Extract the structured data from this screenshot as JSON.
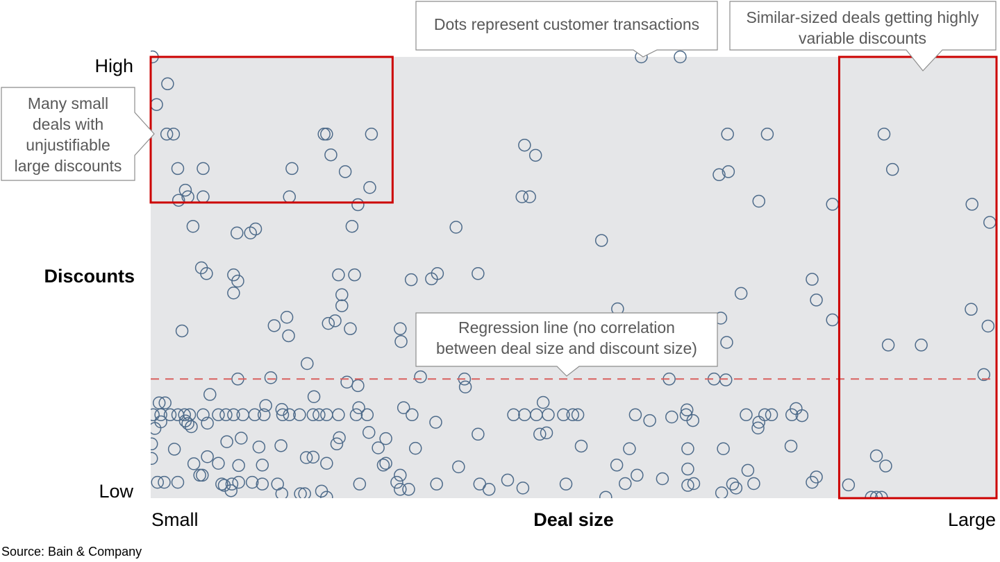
{
  "chart_data": {
    "type": "scatter",
    "title": "",
    "xlabel": "Deal size",
    "ylabel": "Discounts",
    "x_tick_labels": {
      "min": "Small",
      "max": "Large"
    },
    "y_tick_labels": {
      "min": "Low",
      "max": "High"
    },
    "xlim": [
      0,
      100
    ],
    "ylim": [
      0,
      100
    ],
    "grid": false,
    "colors": {
      "plot_bg": "#e5e6e8",
      "marker": "#4e6b8a",
      "regression": "#d9615f",
      "highlight": "#cc0000",
      "callout_border": "#8c8c8c",
      "callout_text": "#595959"
    },
    "regression_line": {
      "y": 27,
      "style": "dashed"
    },
    "highlight_regions": [
      {
        "name": "small-deals-large-discounts",
        "x": [
          0,
          28.6
        ],
        "y": [
          67,
          100
        ]
      },
      {
        "name": "large-deals-variable-discounts",
        "x": [
          81.4,
          100
        ],
        "y": [
          0,
          100
        ]
      }
    ],
    "annotations": [
      {
        "name": "many-small-deals",
        "text": [
          "Many small",
          "deals with",
          "unjustifiable",
          "large discounts"
        ]
      },
      {
        "name": "dots-represent",
        "text": [
          "Dots represent customer transactions"
        ]
      },
      {
        "name": "similar-sized-deals",
        "text": [
          "Similar-sized deals getting highly",
          "variable discounts"
        ]
      },
      {
        "name": "regression-line-note",
        "text": [
          "Regression line (no correlation",
          "between deal size and discount size)"
        ]
      }
    ],
    "points": [
      [
        0.2,
        100
      ],
      [
        2.0,
        93.9
      ],
      [
        0.7,
        89.2
      ],
      [
        1.9,
        82.5
      ],
      [
        2.7,
        82.5
      ],
      [
        3.2,
        74.7
      ],
      [
        6.2,
        74.7
      ],
      [
        16.7,
        74.7
      ],
      [
        20.5,
        82.5
      ],
      [
        20.8,
        82.5
      ],
      [
        21.3,
        77.8
      ],
      [
        26.1,
        82.5
      ],
      [
        23.0,
        74.0
      ],
      [
        25.9,
        70.4
      ],
      [
        4.1,
        69.8
      ],
      [
        3.3,
        67.5
      ],
      [
        4.4,
        68.3
      ],
      [
        6.2,
        68.3
      ],
      [
        16.4,
        68.3
      ],
      [
        24.5,
        66.5
      ],
      [
        5.0,
        61.6
      ],
      [
        10.2,
        60.1
      ],
      [
        11.8,
        60.1
      ],
      [
        12.4,
        61.0
      ],
      [
        23.8,
        61.6
      ],
      [
        6.0,
        52.2
      ],
      [
        6.6,
        50.9
      ],
      [
        9.8,
        50.6
      ],
      [
        10.3,
        49.2
      ],
      [
        9.8,
        46.5
      ],
      [
        22.2,
        50.6
      ],
      [
        24.1,
        50.6
      ],
      [
        22.6,
        46.1
      ],
      [
        22.6,
        43.6
      ],
      [
        3.7,
        37.9
      ],
      [
        14.6,
        39.1
      ],
      [
        16.1,
        41.0
      ],
      [
        16.3,
        36.8
      ],
      [
        21.0,
        39.6
      ],
      [
        21.8,
        40.2
      ],
      [
        23.6,
        38.4
      ],
      [
        18.5,
        30.5
      ],
      [
        10.3,
        27.0
      ],
      [
        14.2,
        27.3
      ],
      [
        23.2,
        26.3
      ],
      [
        24.5,
        25.5
      ],
      [
        29.5,
        38.4
      ],
      [
        29.6,
        35.5
      ],
      [
        31.9,
        27.5
      ],
      [
        37.1,
        27.0
      ],
      [
        37.2,
        25.2
      ],
      [
        30.8,
        49.5
      ],
      [
        33.2,
        49.7
      ],
      [
        33.9,
        50.9
      ],
      [
        38.7,
        50.9
      ],
      [
        36.1,
        61.4
      ],
      [
        43.9,
        68.3
      ],
      [
        44.8,
        68.3
      ],
      [
        44.2,
        80.0
      ],
      [
        45.5,
        77.7
      ],
      [
        53.3,
        58.4
      ],
      [
        55.2,
        42.9
      ],
      [
        58.0,
        100
      ],
      [
        62.6,
        100
      ],
      [
        68.2,
        82.5
      ],
      [
        72.9,
        82.5
      ],
      [
        67.2,
        73.3
      ],
      [
        68.3,
        74.0
      ],
      [
        71.9,
        67.3
      ],
      [
        80.6,
        66.6
      ],
      [
        69.8,
        46.4
      ],
      [
        78.2,
        49.6
      ],
      [
        78.7,
        44.9
      ],
      [
        67.4,
        40.8
      ],
      [
        68.1,
        35.3
      ],
      [
        80.6,
        40.4
      ],
      [
        68.0,
        26.8
      ],
      [
        61.3,
        27.0
      ],
      [
        66.6,
        27.0
      ],
      [
        86.7,
        82.5
      ],
      [
        87.7,
        74.5
      ],
      [
        97.1,
        66.6
      ],
      [
        99.2,
        62.5
      ],
      [
        97.0,
        42.8
      ],
      [
        99.0,
        39.0
      ],
      [
        87.2,
        34.7
      ],
      [
        91.1,
        34.7
      ],
      [
        98.5,
        28.0
      ],
      [
        85.8,
        9.6
      ],
      [
        86.9,
        7.3
      ],
      [
        82.5,
        3.0
      ],
      [
        85.2,
        0.2
      ],
      [
        85.8,
        0.2
      ],
      [
        86.4,
        0.2
      ],
      [
        0.3,
        18.9
      ],
      [
        1.0,
        21.6
      ],
      [
        1.7,
        21.6
      ],
      [
        1.2,
        18.9
      ],
      [
        2.3,
        18.9
      ],
      [
        3.2,
        18.9
      ],
      [
        4.0,
        18.9
      ],
      [
        4.6,
        18.9
      ],
      [
        6.2,
        18.9
      ],
      [
        8.0,
        18.9
      ],
      [
        8.9,
        18.9
      ],
      [
        9.8,
        18.9
      ],
      [
        10.9,
        18.9
      ],
      [
        12.3,
        18.9
      ],
      [
        13.4,
        18.9
      ],
      [
        15.6,
        18.9
      ],
      [
        16.4,
        18.9
      ],
      [
        17.6,
        18.9
      ],
      [
        19.2,
        18.9
      ],
      [
        19.9,
        18.9
      ],
      [
        20.8,
        18.9
      ],
      [
        22.2,
        18.9
      ],
      [
        24.3,
        18.9
      ],
      [
        25.6,
        18.9
      ],
      [
        15.5,
        20.1
      ],
      [
        13.6,
        21.0
      ],
      [
        1.2,
        17.3
      ],
      [
        0.5,
        15.8
      ],
      [
        4.1,
        17.5
      ],
      [
        4.4,
        16.9
      ],
      [
        4.8,
        16.2
      ],
      [
        6.7,
        17.0
      ],
      [
        7.0,
        23.5
      ],
      [
        19.3,
        23.0
      ],
      [
        24.6,
        20.5
      ],
      [
        0.1,
        12.3
      ],
      [
        0.1,
        9.0
      ],
      [
        2.8,
        11.1
      ],
      [
        5.1,
        7.8
      ],
      [
        6.1,
        5.2
      ],
      [
        6.7,
        9.4
      ],
      [
        8.0,
        7.9
      ],
      [
        9.0,
        12.8
      ],
      [
        10.4,
        7.4
      ],
      [
        10.7,
        13.6
      ],
      [
        12.8,
        11.6
      ],
      [
        13.2,
        7.5
      ],
      [
        15.4,
        11.9
      ],
      [
        18.4,
        9.2
      ],
      [
        19.2,
        9.3
      ],
      [
        20.8,
        7.9
      ],
      [
        22.0,
        12.3
      ],
      [
        22.3,
        13.7
      ],
      [
        25.8,
        14.9
      ],
      [
        27.5,
        7.5
      ],
      [
        27.8,
        7.9
      ],
      [
        26.9,
        11.4
      ],
      [
        27.8,
        13.5
      ],
      [
        31.3,
        11.3
      ],
      [
        0.8,
        3.6
      ],
      [
        1.6,
        3.6
      ],
      [
        3.2,
        3.6
      ],
      [
        5.8,
        5.2
      ],
      [
        8.4,
        3.2
      ],
      [
        8.7,
        2.9
      ],
      [
        9.5,
        1.7
      ],
      [
        9.6,
        3.2
      ],
      [
        10.4,
        3.6
      ],
      [
        12.0,
        3.6
      ],
      [
        13.2,
        3.2
      ],
      [
        15.0,
        3.2
      ],
      [
        15.5,
        1.0
      ],
      [
        17.7,
        1.0
      ],
      [
        18.2,
        1.0
      ],
      [
        20.2,
        1.6
      ],
      [
        20.8,
        0.2
      ],
      [
        24.7,
        3.2
      ],
      [
        29.5,
        5.2
      ],
      [
        29.1,
        3.6
      ],
      [
        29.5,
        2.0
      ],
      [
        30.5,
        2.0
      ],
      [
        42.9,
        18.9
      ],
      [
        44.2,
        18.9
      ],
      [
        45.6,
        18.9
      ],
      [
        47.0,
        18.9
      ],
      [
        48.8,
        18.9
      ],
      [
        49.9,
        18.9
      ],
      [
        50.5,
        18.9
      ],
      [
        46.4,
        21.7
      ],
      [
        46.0,
        14.5
      ],
      [
        46.8,
        14.8
      ],
      [
        63.3,
        18.9
      ],
      [
        64.1,
        17.6
      ],
      [
        61.6,
        18.4
      ],
      [
        57.3,
        18.9
      ],
      [
        59.0,
        17.6
      ],
      [
        63.4,
        20.0
      ],
      [
        70.4,
        18.9
      ],
      [
        73.4,
        18.9
      ],
      [
        71.9,
        17.2
      ],
      [
        71.8,
        15.9
      ],
      [
        75.8,
        18.9
      ],
      [
        77.0,
        18.7
      ],
      [
        76.3,
        20.3
      ],
      [
        72.6,
        18.9
      ],
      [
        50.9,
        11.8
      ],
      [
        56.6,
        11.2
      ],
      [
        55.1,
        7.5
      ],
      [
        63.5,
        11.2
      ],
      [
        63.5,
        6.6
      ],
      [
        56.1,
        3.3
      ],
      [
        63.5,
        2.9
      ],
      [
        64.2,
        3.3
      ],
      [
        60.5,
        4.4
      ],
      [
        67.7,
        11.2
      ],
      [
        70.6,
        6.3
      ],
      [
        71.3,
        3.3
      ],
      [
        75.7,
        11.8
      ],
      [
        69.2,
        2.3
      ],
      [
        68.8,
        3.2
      ],
      [
        78.2,
        3.6
      ],
      [
        78.7,
        4.8
      ],
      [
        67.5,
        1.2
      ],
      [
        33.8,
        3.2
      ],
      [
        36.4,
        7.1
      ],
      [
        38.9,
        3.2
      ],
      [
        40.0,
        2.0
      ],
      [
        42.2,
        4.1
      ],
      [
        44.0,
        2.3
      ],
      [
        49.1,
        3.2
      ],
      [
        53.8,
        0.2
      ],
      [
        57.5,
        5.2
      ],
      [
        38.7,
        14.5
      ],
      [
        33.7,
        17.2
      ],
      [
        30.9,
        18.9
      ],
      [
        29.9,
        20.5
      ]
    ]
  },
  "source": "Source: Bain & Company"
}
